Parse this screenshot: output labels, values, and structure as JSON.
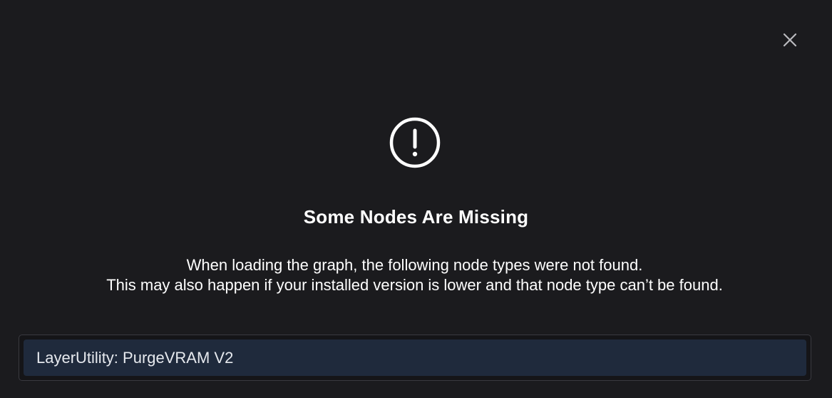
{
  "dialog": {
    "title": "Some Nodes Are Missing",
    "message_lines": [
      "When loading the graph, the following node types were not found.",
      "This may also happen if your installed version is lower and that node type can’t be found."
    ],
    "missing_nodes": [
      "LayerUtility: PurgeVRAM V2"
    ],
    "icons": {
      "close": "close-icon",
      "warning": "exclamation-circle-icon"
    }
  },
  "colors": {
    "background": "#1b1b1e",
    "item_background": "#1f2a3c",
    "text": "#ffffff"
  }
}
